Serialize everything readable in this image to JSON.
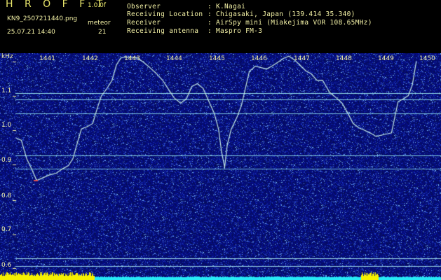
{
  "header": {
    "app_title": "H R O F F T",
    "version": "1.0.0f",
    "filename": "KN9_2507211440.png",
    "datetime": "25.07.21 14:40",
    "meteor_label": "meteor",
    "meteor_count": "21"
  },
  "info": [
    {
      "label": "Observer",
      "value": "K.Nagai"
    },
    {
      "label": "Receiving Location",
      "value": "Chigasaki, Japan (139.414 35.340)"
    },
    {
      "label": "Receiver",
      "value": "AirSpy mini (Miakejima VOR 108.65MHz)"
    },
    {
      "label": "Receiving antenna",
      "value": "Maspro FM-3"
    }
  ],
  "separator": ":",
  "y_axis": {
    "unit": "kHz",
    "ticks": [
      "1.1",
      "1.0",
      "0.9",
      "0.8",
      "0.7",
      "0.6"
    ]
  },
  "x_axis": {
    "minutes": [
      "1441",
      "1442",
      "1443",
      "1444",
      "1445",
      "1446",
      "1447",
      "1448",
      "1449",
      "1450"
    ]
  },
  "colors": {
    "background_noise": "#0b1a8c",
    "trace": "#bfe9e0",
    "bottom_bar_yellow": "#f5f000",
    "bottom_bar_cyan": "#28e8f5",
    "text": "#f4f2a6"
  }
}
